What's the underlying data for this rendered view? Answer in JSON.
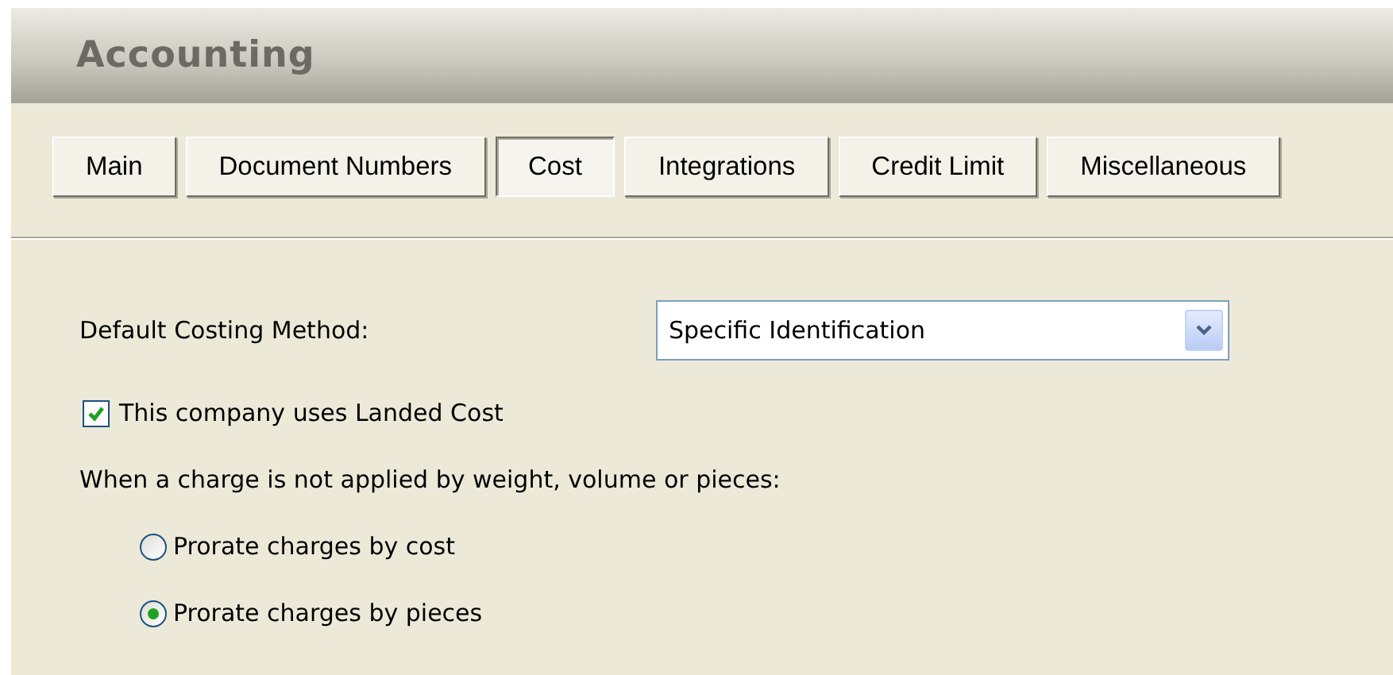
{
  "header": {
    "title": "Accounting"
  },
  "tabs": [
    {
      "label": "Main",
      "selected": false
    },
    {
      "label": "Document Numbers",
      "selected": false
    },
    {
      "label": "Cost",
      "selected": true
    },
    {
      "label": "Integrations",
      "selected": false
    },
    {
      "label": "Credit Limit",
      "selected": false
    },
    {
      "label": "Miscellaneous",
      "selected": false
    }
  ],
  "costing_method": {
    "label": "Default Costing Method:",
    "value": "Specific Identification"
  },
  "landed_cost": {
    "label": "This company uses Landed Cost",
    "checked": true
  },
  "charge_rule": {
    "prompt": "When a charge is not applied by weight, volume or pieces:",
    "options": [
      {
        "label": "Prorate charges by cost",
        "selected": false
      },
      {
        "label": "Prorate charges by pieces",
        "selected": true
      }
    ]
  }
}
